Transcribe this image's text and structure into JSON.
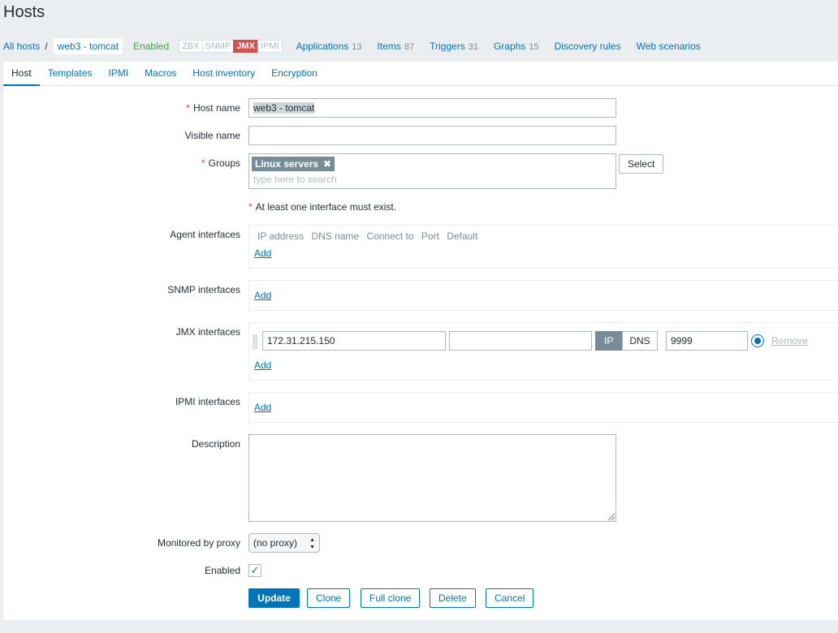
{
  "page": {
    "title": "Hosts"
  },
  "host_nav": {
    "all_hosts": "All hosts",
    "separator": "/",
    "current_host": "web3 - tomcat",
    "status": "Enabled",
    "availability": [
      "ZBX",
      "SNMP",
      "JMX",
      "IPMI"
    ],
    "links": [
      {
        "label": "Applications",
        "count": "13"
      },
      {
        "label": "Items",
        "count": "87"
      },
      {
        "label": "Triggers",
        "count": "31"
      },
      {
        "label": "Graphs",
        "count": "15"
      },
      {
        "label": "Discovery rules",
        "count": ""
      },
      {
        "label": "Web scenarios",
        "count": ""
      }
    ]
  },
  "tabs": [
    "Host",
    "Templates",
    "IPMI",
    "Macros",
    "Host inventory",
    "Encryption"
  ],
  "form": {
    "required_mark": "*",
    "host_name": {
      "label": "Host name",
      "value": "web3 - tomcat"
    },
    "visible_name": {
      "label": "Visible name",
      "value": ""
    },
    "groups": {
      "label": "Groups",
      "chip": "Linux servers",
      "chip_remove": "✖",
      "placeholder": "type here to search",
      "select_button": "Select"
    },
    "interface_note": "At least one interface must exist.",
    "agent_interfaces": {
      "label": "Agent interfaces",
      "headers": [
        "IP address",
        "DNS name",
        "Connect to",
        "Port",
        "Default"
      ],
      "add": "Add"
    },
    "snmp_interfaces": {
      "label": "SNMP interfaces",
      "add": "Add"
    },
    "jmx_interfaces": {
      "label": "JMX interfaces",
      "ip": "172.31.215.150",
      "dns": "",
      "connect_ip": "IP",
      "connect_dns": "DNS",
      "connect_selected": "IP",
      "port": "9999",
      "remove": "Remove",
      "add": "Add"
    },
    "ipmi_interfaces": {
      "label": "IPMI interfaces",
      "add": "Add"
    },
    "description": {
      "label": "Description",
      "value": ""
    },
    "proxy": {
      "label": "Monitored by proxy",
      "value": "(no proxy)"
    },
    "enabled": {
      "label": "Enabled",
      "checked": true,
      "check_glyph": "✓"
    },
    "buttons": {
      "update": "Update",
      "clone": "Clone",
      "full_clone": "Full clone",
      "delete": "Delete",
      "cancel": "Cancel"
    }
  },
  "colors": {
    "link": "#0275b8",
    "enabled": "#429e47",
    "jmx_available": "#d64e4e",
    "required": "#d64e4e"
  }
}
